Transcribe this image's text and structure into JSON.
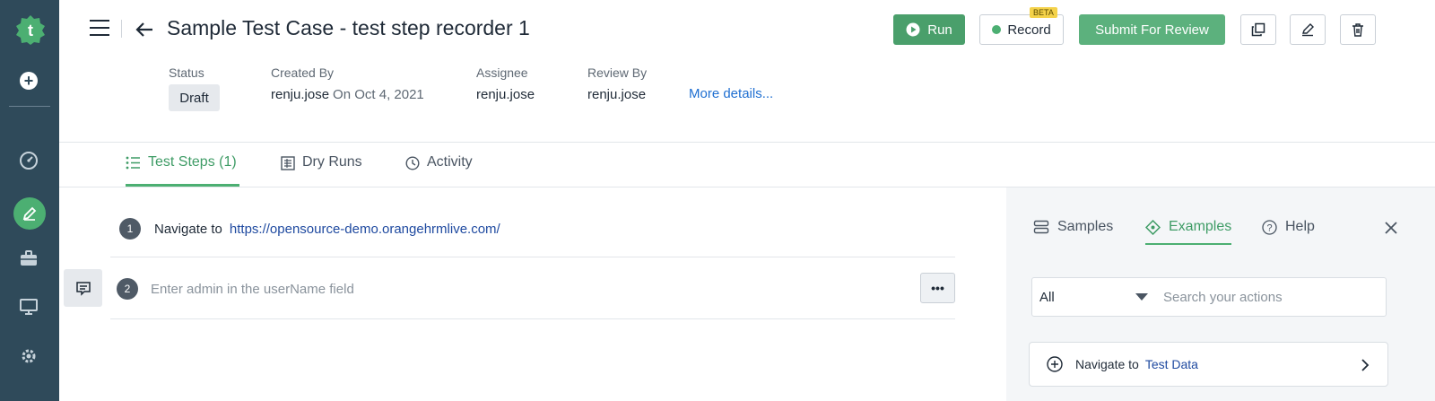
{
  "colors": {
    "sidebar": "#2f4a5a",
    "brand_green": "#4caf72",
    "run": "#4a9f6b",
    "submit": "#5cb17d",
    "link": "#1f6fd1"
  },
  "sidebar": {
    "logo_icon": "testsigma-logo-icon",
    "items": [
      {
        "icon": "plus-circle-icon"
      },
      {
        "icon": "dashboard-gauge-icon"
      },
      {
        "icon": "pencil-icon",
        "active": true
      },
      {
        "icon": "briefcase-icon"
      },
      {
        "icon": "monitor-icon"
      },
      {
        "icon": "settings-gear-icon"
      }
    ]
  },
  "header": {
    "title": "Sample Test Case - test step recorder 1",
    "run_label": "Run",
    "record_label": "Record",
    "beta_label": "BETA",
    "submit_label": "Submit For Review"
  },
  "meta": {
    "status_label": "Status",
    "status_value": "Draft",
    "created_by_label": "Created By",
    "created_by_value": "renju.jose",
    "created_on": "On Oct 4, 2021",
    "assignee_label": "Assignee",
    "assignee_value": "renju.jose",
    "review_by_label": "Review By",
    "review_by_value": "renju.jose",
    "more_details": "More details..."
  },
  "tabs": [
    {
      "label": "Test Steps (1)",
      "active": true
    },
    {
      "label": "Dry Runs"
    },
    {
      "label": "Activity"
    }
  ],
  "steps": [
    {
      "number": "1",
      "action": "Navigate to",
      "value": "https://opensource-demo.orangehrmlive.com/"
    },
    {
      "number": "2",
      "placeholder": "Enter admin in the userName field"
    }
  ],
  "more_button": "•••",
  "panel": {
    "tabs": [
      {
        "label": "Samples"
      },
      {
        "label": "Examples",
        "active": true
      },
      {
        "label": "Help"
      }
    ],
    "filter_value": "All",
    "search_placeholder": "Search your actions",
    "action": {
      "prefix": "Navigate to",
      "target": "Test Data"
    }
  }
}
